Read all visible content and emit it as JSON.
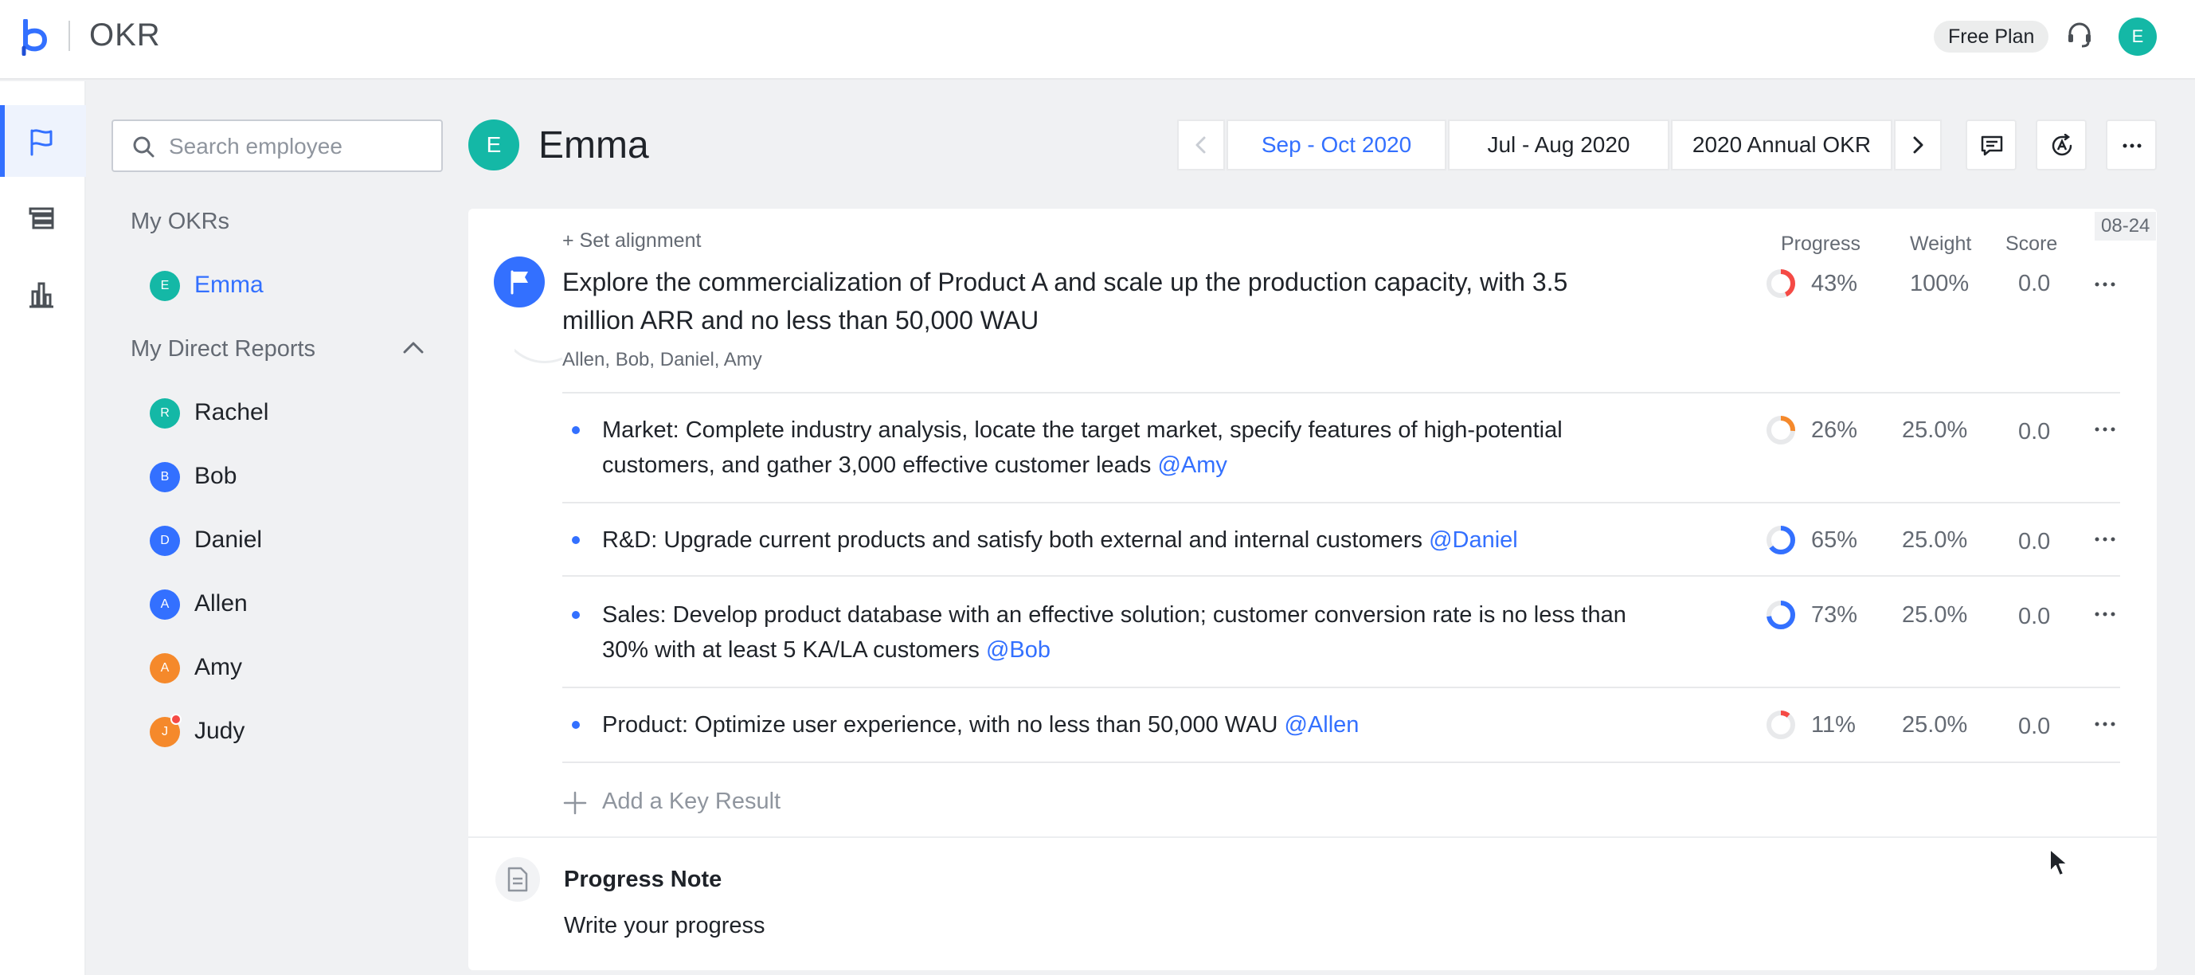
{
  "app": {
    "title": "OKR",
    "plan_badge": "Free Plan",
    "user_initial": "E"
  },
  "rail": {
    "items": [
      "okr-flag-icon",
      "list-icon",
      "bar-chart-icon"
    ],
    "active": 0
  },
  "sidebar": {
    "search_placeholder": "Search employee",
    "my_okrs_heading": "My OKRs",
    "my_okrs": [
      {
        "initial": "E",
        "name": "Emma",
        "color": "#14b8a6",
        "selected": true
      }
    ],
    "reports_heading": "My Direct Reports",
    "reports": [
      {
        "initial": "R",
        "name": "Rachel",
        "color": "#14b8a6"
      },
      {
        "initial": "B",
        "name": "Bob",
        "color": "#3370ff"
      },
      {
        "initial": "D",
        "name": "Daniel",
        "color": "#3370ff"
      },
      {
        "initial": "A",
        "name": "Allen",
        "color": "#3370ff"
      },
      {
        "initial": "A",
        "name": "Amy",
        "color": "#f5892b"
      },
      {
        "initial": "J",
        "name": "Judy",
        "color": "#f5892b",
        "notification": true
      }
    ]
  },
  "header": {
    "owner_initial": "E",
    "owner_name": "Emma",
    "periods": [
      "Sep - Oct 2020",
      "Jul - Aug 2020",
      "2020 Annual OKR"
    ],
    "active_period": 0
  },
  "okr": {
    "date_tag": "08-24",
    "set_alignment": "Set alignment",
    "columns": {
      "progress": "Progress",
      "weight": "Weight",
      "score": "Score"
    },
    "objective": {
      "title": "Explore the commercialization of Product A and scale up the production capacity, with 3.5 million ARR and no less than 50,000 WAU",
      "owners": "Allen, Bob, Daniel, Amy",
      "progress": "43%",
      "progress_value": 0.43,
      "progress_color": "#f54a45",
      "weight": "100%",
      "score": "0.0"
    },
    "key_results": [
      {
        "text": "Market: Complete industry analysis, locate the target market, specify features of high-potential customers, and gather 3,000 effective customer leads",
        "mention": "@Amy",
        "progress": "26%",
        "progress_value": 0.26,
        "progress_color": "#f5892b",
        "weight": "25.0%",
        "score": "0.0"
      },
      {
        "text": "R&D: Upgrade current products and satisfy both external and internal customers",
        "mention": "@Daniel",
        "progress": "65%",
        "progress_value": 0.65,
        "progress_color": "#3370ff",
        "weight": "25.0%",
        "score": "0.0"
      },
      {
        "text": "Sales: Develop product database with an effective solution; customer conversion rate is no less than 30% with at least 5 KA/LA customers",
        "mention": "@Bob",
        "progress": "73%",
        "progress_value": 0.73,
        "progress_color": "#3370ff",
        "weight": "25.0%",
        "score": "0.0"
      },
      {
        "text": "Product: Optimize user experience, with no less than 50,000 WAU",
        "mention": "@Allen",
        "progress": "11%",
        "progress_value": 0.11,
        "progress_color": "#f54a45",
        "weight": "25.0%",
        "score": "0.0"
      }
    ],
    "add_kr_label": "Add a Key Result",
    "progress_note": {
      "title": "Progress Note",
      "placeholder": "Write your progress"
    }
  }
}
